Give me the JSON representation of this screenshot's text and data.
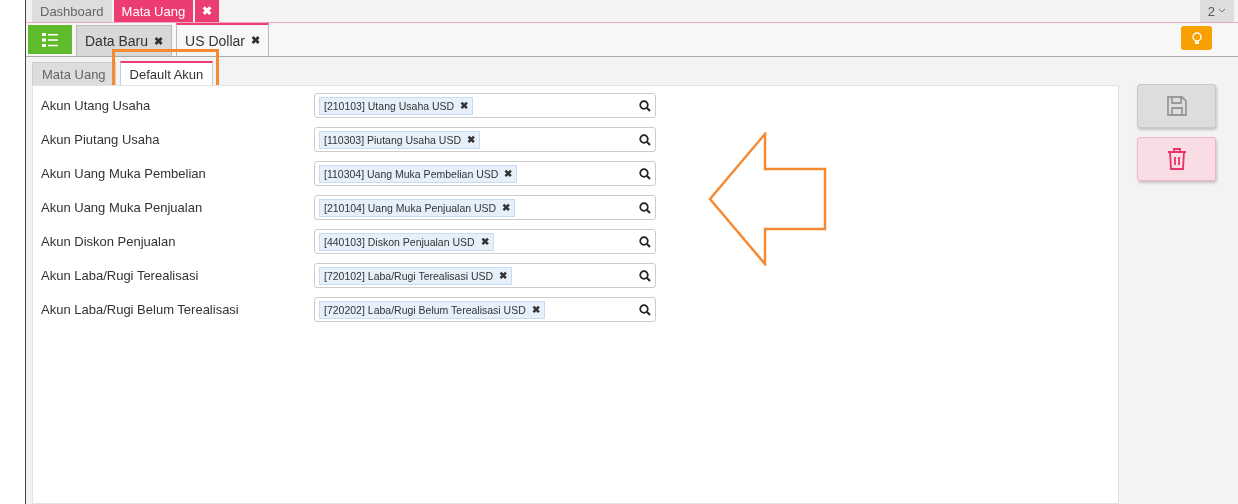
{
  "top_tabs": [
    {
      "label": "Dashboard",
      "selected": false
    },
    {
      "label": "Mata Uang",
      "selected": true,
      "close": "✖"
    }
  ],
  "window_count": "2",
  "doc_tabs": [
    {
      "label": "Data Baru",
      "close": "✖",
      "selected": false
    },
    {
      "label": "US Dollar",
      "close": "✖",
      "selected": true
    }
  ],
  "sub_tabs": [
    {
      "label": "Mata Uang",
      "selected": false
    },
    {
      "label": "Default Akun",
      "selected": true,
      "highlighted": true
    }
  ],
  "fields": [
    {
      "label": "Akun Utang Usaha",
      "value": "[210103] Utang Usaha USD",
      "remove": "✖"
    },
    {
      "label": "Akun Piutang Usaha",
      "value": "[110303] Piutang Usaha USD",
      "remove": "✖"
    },
    {
      "label": "Akun Uang Muka Pembelian",
      "value": "[110304] Uang Muka Pembelian USD",
      "remove": "✖"
    },
    {
      "label": "Akun Uang Muka Penjualan",
      "value": "[210104] Uang Muka Penjualan USD",
      "remove": "✖"
    },
    {
      "label": "Akun Diskon Penjualan",
      "value": "[440103] Diskon Penjualan USD",
      "remove": "✖"
    },
    {
      "label": "Akun Laba/Rugi Terealisasi",
      "value": "[720102] Laba/Rugi Terealisasi USD",
      "remove": "✖"
    },
    {
      "label": "Akun Laba/Rugi Belum Terealisasi",
      "value": "[720202] Laba/Rugi Belum Terealisasi USD",
      "remove": "✖"
    }
  ],
  "annotation_arrow": true
}
